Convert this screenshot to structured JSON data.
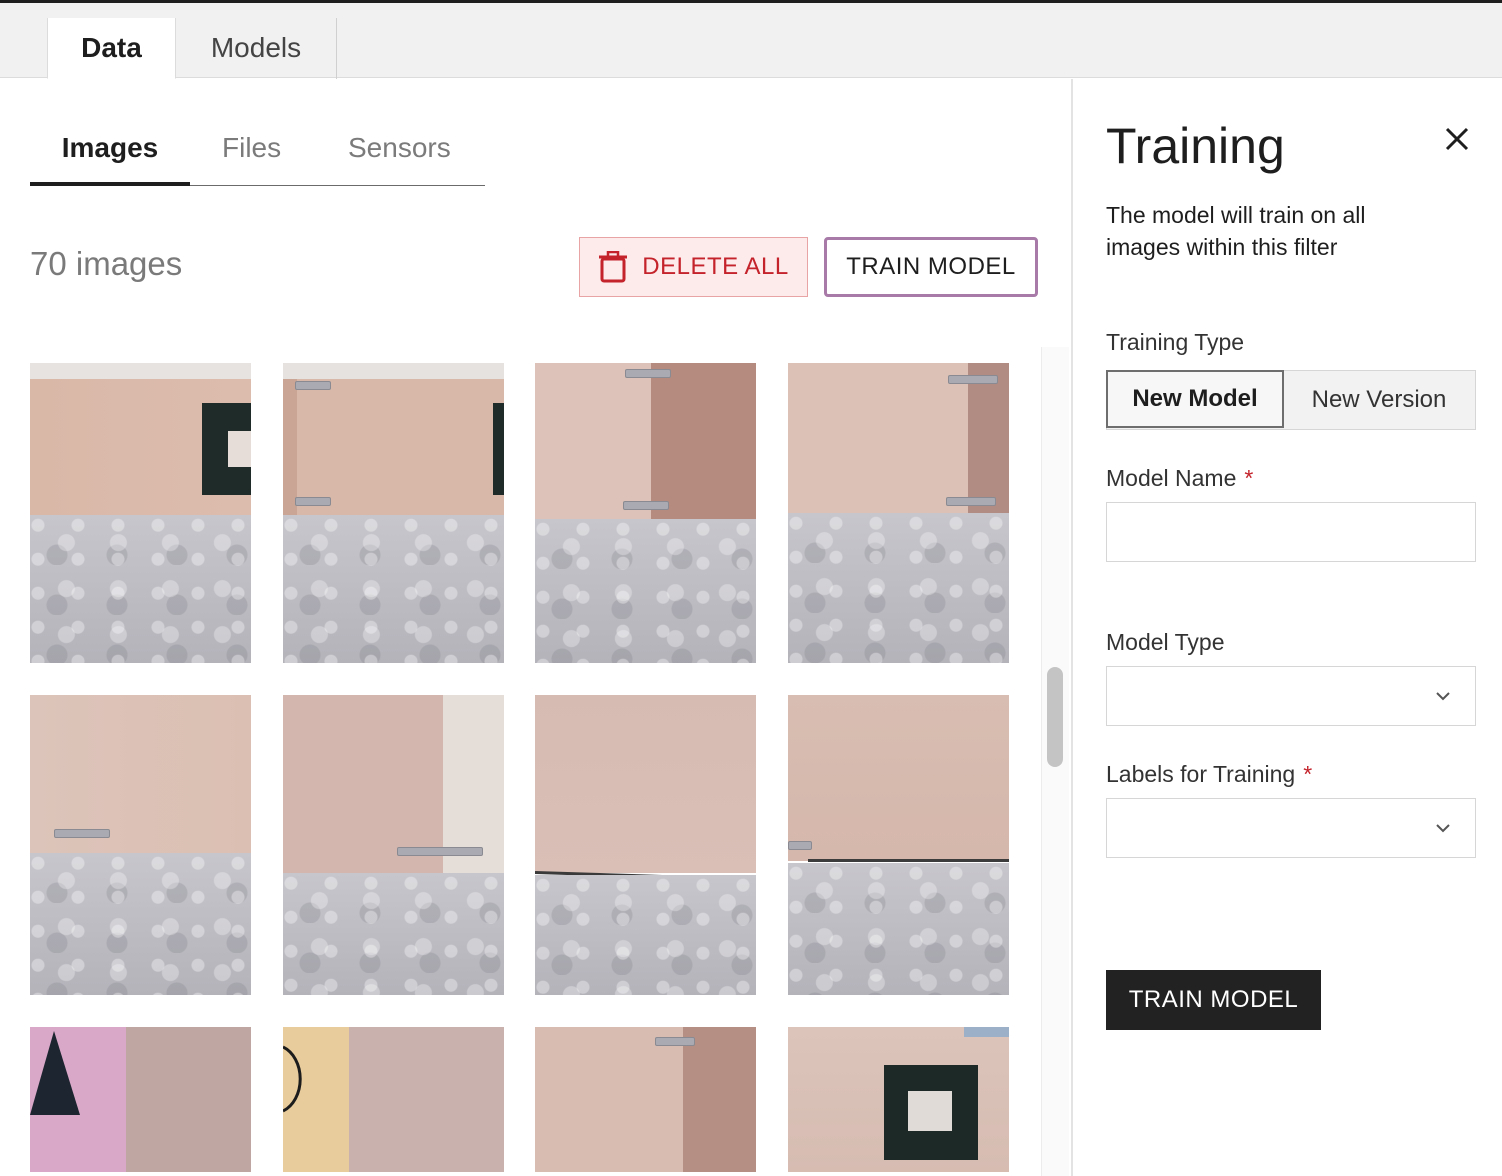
{
  "top_tabs": [
    {
      "label": "Data",
      "active": true
    },
    {
      "label": "Models",
      "active": false
    }
  ],
  "sub_tabs": [
    {
      "label": "Images",
      "active": true
    },
    {
      "label": "Files",
      "active": false
    },
    {
      "label": "Sensors",
      "active": false
    }
  ],
  "images": {
    "count_label": "70 images"
  },
  "toolbar": {
    "delete_label": "DELETE ALL",
    "train_label": "TRAIN MODEL"
  },
  "panel": {
    "title": "Training",
    "description": "The model will train on all images within this filter",
    "training_type_label": "Training Type",
    "training_type_options": [
      "New Model",
      "New Version"
    ],
    "training_type_selected": "New Model",
    "model_name_label": "Model Name",
    "model_name_value": "",
    "model_type_label": "Model Type",
    "model_type_value": "",
    "labels_label": "Labels for Training",
    "labels_value": "",
    "required_mark": "*",
    "train_button": "TRAIN MODEL"
  },
  "icons": {
    "delete": "trash-icon",
    "close": "close-icon",
    "dropdown": "chevron-down-icon"
  },
  "colors": {
    "danger": "#c4232b",
    "train_border": "#a77aa7",
    "primary_dark": "#222222"
  }
}
